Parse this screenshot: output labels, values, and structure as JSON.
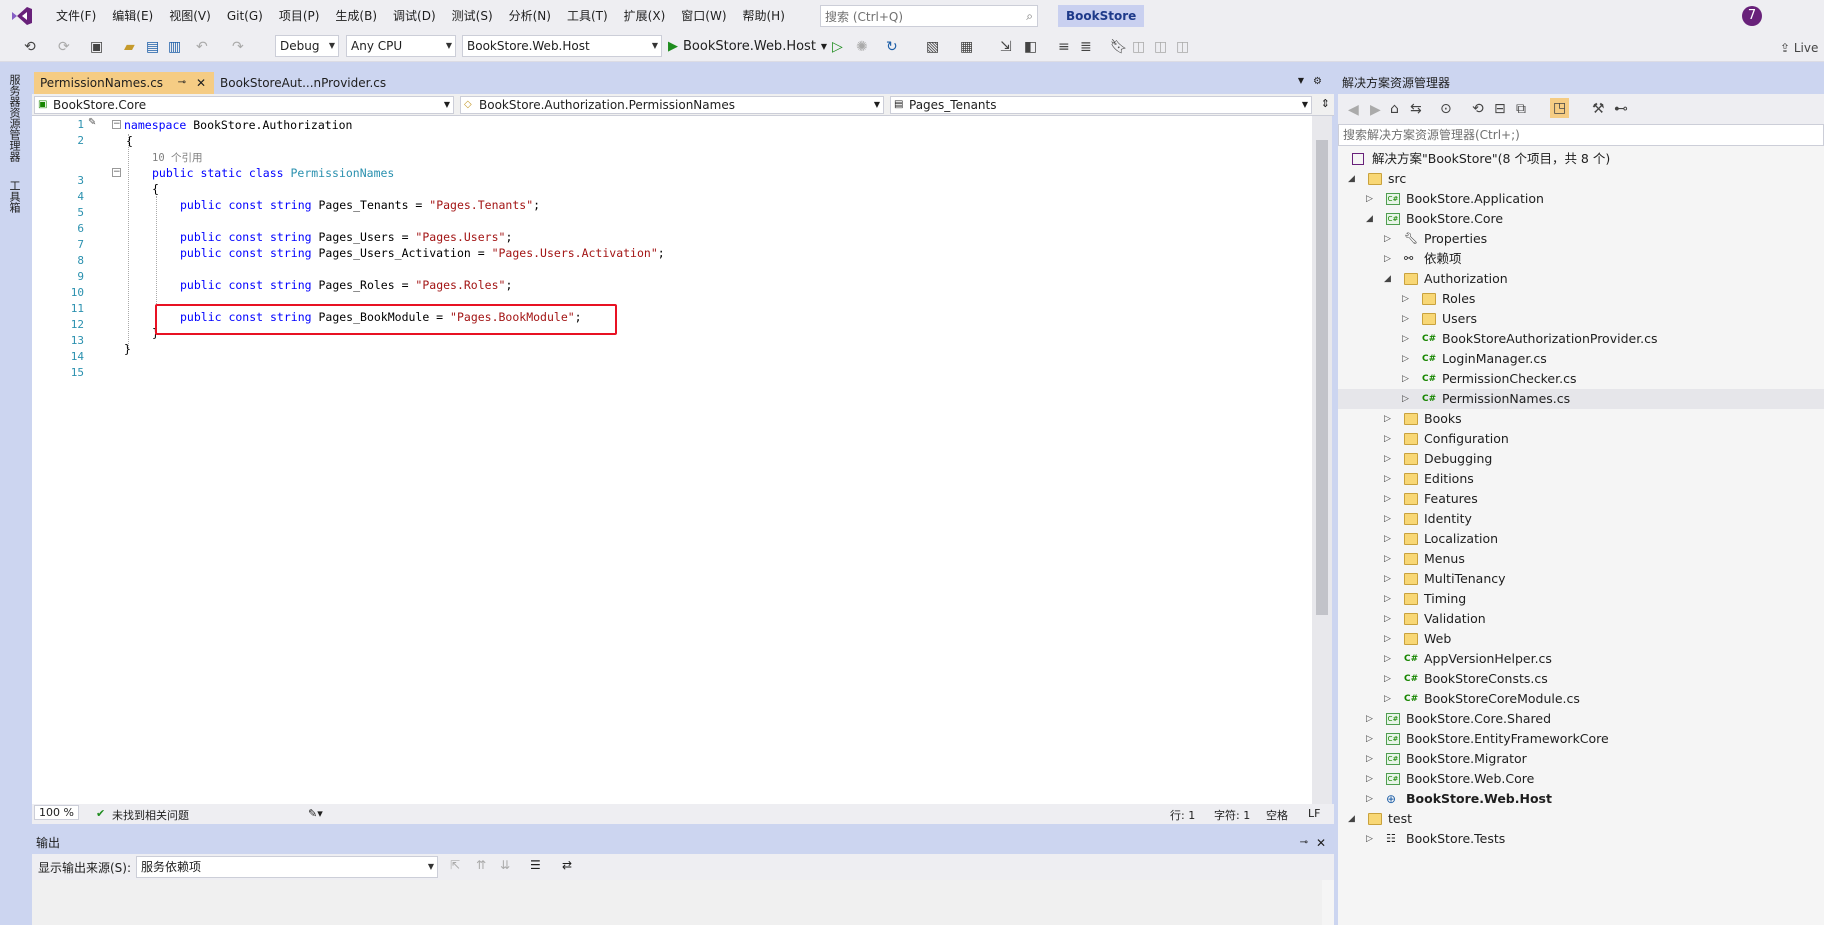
{
  "menu": [
    "文件(F)",
    "编辑(E)",
    "视图(V)",
    "Git(G)",
    "项目(P)",
    "生成(B)",
    "调试(D)",
    "测试(S)",
    "分析(N)",
    "工具(T)",
    "扩展(X)",
    "窗口(W)",
    "帮助(H)"
  ],
  "search": {
    "placeholder": "搜索 (Ctrl+Q)"
  },
  "title": "BookStore",
  "avatar": "7",
  "toolbar": {
    "config": "Debug",
    "platform": "Any CPU",
    "startup": "BookStore.Web.Host",
    "run_label": "BookStore.Web.Host",
    "live": "Live"
  },
  "left_tabs": [
    "服务器资源管理器",
    "工具箱"
  ],
  "tabs": {
    "active": "PermissionNames.cs",
    "inactive": "BookStoreAut...nProvider.cs"
  },
  "navbar": {
    "project": "BookStore.Core",
    "type": "BookStore.Authorization.PermissionNames",
    "member": "Pages_Tenants"
  },
  "code": {
    "lines": [
      "1",
      "2",
      "3",
      "4",
      "5",
      "6",
      "7",
      "8",
      "9",
      "10",
      "11",
      "12",
      "13",
      "14",
      "15"
    ],
    "ns_kw": "namespace",
    "ns_name": " BookStore.Authorization",
    "refs": "10 个引用",
    "class_decl_kw": "public static class ",
    "class_name": "PermissionNames",
    "l5a": "public const string ",
    "l5b": "Pages_Tenants = ",
    "l5c": "\"Pages.Tenants\"",
    "l7a": "public const string ",
    "l7b": "Pages_Users = ",
    "l7c": "\"Pages.Users\"",
    "l8a": "public const string ",
    "l8b": "Pages_Users_Activation = ",
    "l8c": "\"Pages.Users.Activation\"",
    "l10a": "public const string ",
    "l10b": "Pages_Roles = ",
    "l10c": "\"Pages.Roles\"",
    "l12a": "public const string ",
    "l12b": "Pages_BookModule = ",
    "l12c": "\"Pages.BookModule\"",
    "semi": ";",
    "open": "{",
    "close": "}"
  },
  "status": {
    "zoom": "100 %",
    "issues": "未找到相关问题",
    "line": "行: 1",
    "col": "字符: 1",
    "spc": "空格",
    "eol": "LF"
  },
  "output": {
    "title": "输出",
    "source_label": "显示输出来源(S):",
    "source_value": "服务依赖项"
  },
  "solution": {
    "title": "解决方案资源管理器",
    "search": "搜索解决方案资源管理器(Ctrl+;)",
    "root": "解决方案\"BookStore\"(8 个项目，共 8 个)",
    "items": [
      "src",
      "BookStore.Application",
      "BookStore.Core",
      "Properties",
      "依赖项",
      "Authorization",
      "Roles",
      "Users",
      "BookStoreAuthorizationProvider.cs",
      "LoginManager.cs",
      "PermissionChecker.cs",
      "PermissionNames.cs",
      "Books",
      "Configuration",
      "Debugging",
      "Editions",
      "Features",
      "Identity",
      "Localization",
      "Menus",
      "MultiTenancy",
      "Timing",
      "Validation",
      "Web",
      "AppVersionHelper.cs",
      "BookStoreConsts.cs",
      "BookStoreCoreModule.cs",
      "BookStore.Core.Shared",
      "BookStore.EntityFrameworkCore",
      "BookStore.Migrator",
      "BookStore.Web.Core",
      "BookStore.Web.Host",
      "test",
      "BookStore.Tests"
    ]
  }
}
